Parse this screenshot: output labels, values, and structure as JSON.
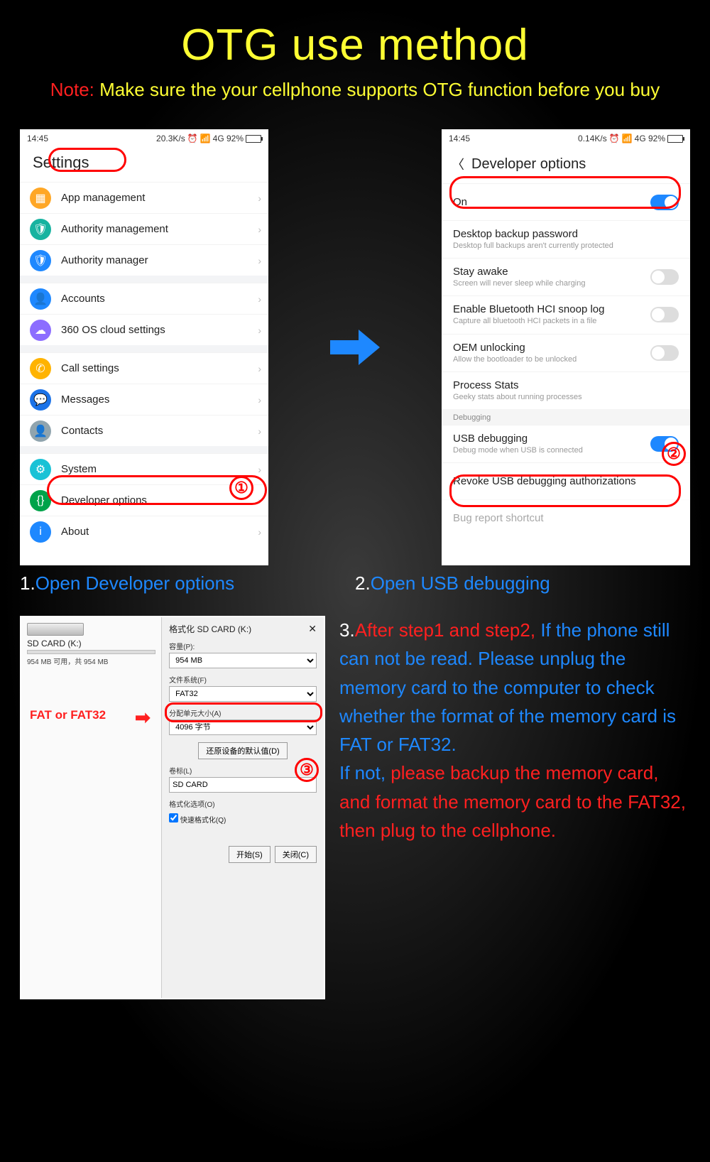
{
  "title": "OTG use method",
  "note_label": "Note:",
  "note_text": "Make sure the your cellphone supports OTG function before you buy",
  "statusbar": {
    "time": "14:45",
    "left_speed": "20.3K/s",
    "right_speed": "0.14K/s",
    "net": "4G 92%"
  },
  "settings": {
    "header": "Settings",
    "group1": [
      {
        "icon_bg": "orange",
        "icon": "▦",
        "label": "App management"
      },
      {
        "icon_bg": "teal",
        "icon": "🛡",
        "label": "Authority management"
      },
      {
        "icon_bg": "blue",
        "icon": "🛡",
        "label": "Authority manager"
      }
    ],
    "group2": [
      {
        "icon_bg": "blue",
        "icon": "👤",
        "label": "Accounts"
      },
      {
        "icon_bg": "purple",
        "icon": "☁",
        "label": "360 OS cloud settings"
      }
    ],
    "group3": [
      {
        "icon_bg": "yell",
        "icon": "✆",
        "label": "Call settings"
      },
      {
        "icon_bg": "dblue",
        "icon": "💬",
        "label": "Messages"
      },
      {
        "icon_bg": "gray",
        "icon": "👤",
        "label": "Contacts"
      }
    ],
    "group4": [
      {
        "icon_bg": "cyan",
        "icon": "⚙",
        "label": "System"
      },
      {
        "icon_bg": "dgreen",
        "icon": "{}",
        "label": "Developer options"
      },
      {
        "icon_bg": "blue",
        "icon": "i",
        "label": "About"
      }
    ]
  },
  "dev": {
    "header": "Developer options",
    "rows": [
      {
        "label": "On",
        "on": true
      },
      {
        "label": "Desktop backup password",
        "sub": "Desktop full backups aren't currently protected"
      },
      {
        "label": "Stay awake",
        "sub": "Screen will never sleep while charging",
        "tog": true
      },
      {
        "label": "Enable Bluetooth HCI snoop log",
        "sub": "Capture all bluetooth HCI packets in a file",
        "tog": true
      },
      {
        "label": "OEM unlocking",
        "sub": "Allow the bootloader to be unlocked",
        "tog": true
      },
      {
        "label": "Process Stats",
        "sub": "Geeky stats about running processes"
      }
    ],
    "section": "Debugging",
    "rows2": [
      {
        "label": "USB debugging",
        "sub": "Debug mode when USB is connected",
        "tog": true,
        "on": true
      },
      {
        "label": "Revoke USB debugging authorizations"
      },
      {
        "label": "Bug report shortcut",
        "faded": true
      }
    ]
  },
  "cap1_num": "1.",
  "cap1": "Open Developer options",
  "cap2_num": "2.",
  "cap2": "Open USB debugging",
  "fmt": {
    "drive_title": "SD CARD (K:)",
    "drive_sub": "954 MB 可用，共 954 MB",
    "dlg_title": "格式化 SD CARD (K:)",
    "capacity_lbl": "容量(P):",
    "capacity_val": "954 MB",
    "fs_lbl": "文件系统(F)",
    "fs_val": "FAT32",
    "au_lbl": "分配单元大小(A)",
    "au_val": "4096 字节",
    "restore": "还原设备的默认值(D)",
    "vol_lbl": "卷标(L)",
    "vol_val": "SD CARD",
    "opts": "格式化选项(O)",
    "quick": "快速格式化(Q)",
    "start": "开始(S)",
    "close": "关闭(C)"
  },
  "fat_label": "FAT or FAT32",
  "step3": {
    "num": "3.",
    "p1": "After step1 and step2,",
    "p2": "If the phone still can not be read. Please unplug the memory card to the computer to check whether the format of the memory card is FAT or FAT32.",
    "p3_a": "If not, ",
    "p3_b": "please backup the memory card, and format the memory card to the FAT32, then plug to the cellphone."
  },
  "circles": {
    "one": "①",
    "two": "②",
    "three": "③"
  }
}
